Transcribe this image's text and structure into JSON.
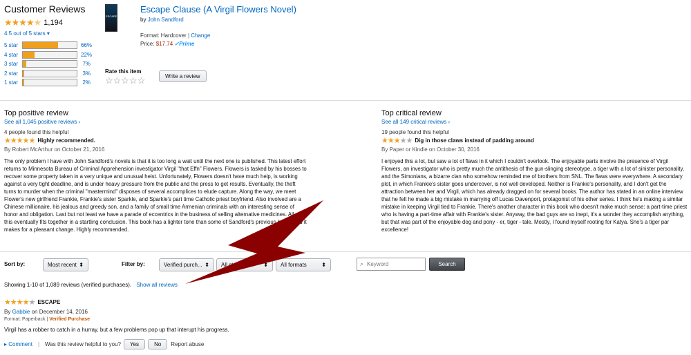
{
  "summary": {
    "title": "Customer Reviews",
    "count": "1,194",
    "rating_text": "4.5 out of 5 stars",
    "rating": 4.5,
    "histogram": [
      {
        "label": "5 star",
        "pct": "66%",
        "value": 66
      },
      {
        "label": "4 star",
        "pct": "22%",
        "value": 22
      },
      {
        "label": "3 star",
        "pct": "7%",
        "value": 7
      },
      {
        "label": "2 star",
        "pct": "3%",
        "value": 3
      },
      {
        "label": "1 star",
        "pct": "2%",
        "value": 2
      }
    ]
  },
  "product": {
    "title": "Escape Clause (A Virgil Flowers Novel)",
    "by": "by",
    "author": "John Sandford",
    "format_label": "Format:",
    "format": "Hardcover",
    "change": "Change",
    "price_label": "Price:",
    "price": "$17.74",
    "prime": "✓Prime",
    "rate_label": "Rate this item",
    "write_review": "Write a review"
  },
  "positive": {
    "heading": "Top positive review",
    "see_all": "See all 1,045 positive reviews ›",
    "helpful": "4 people found this helpful",
    "title": "Highly recommended.",
    "rating": 5,
    "byline": "By Robert McArthur on October 21, 2016",
    "body": "The only problem I have with John Sandford's novels is that it is too long a wait until the next one is published. This latest effort returns to Minnesota Bureau of Criminal Apprehension investigator Virgil \"that Effn\" Flowers. Flowers is tasked by his bosses to recover some property taken in a very unique and unusual heist. Unfortunately, Flowers doesn't have much help, is working against a very tight deadline, and is under heavy pressure from the public and the press to get results. Eventually, the theft turns to murder when the criminal \"mastermind\" disposes of several accomplices to elude capture. Along the way, we meet Flower's new girlfriend Frankie, Frankie's sister Sparkle, and Sparkle's part time Catholic priest boyfriend. Also involved are a Chinese millionaire, his jealous and greedy son, and a family of small time Armenian criminals with an interesting sense of honor and obligation. Last but not least we have a parade of eccentrics in the business of selling alternative medicines. All of this eventually fits together in a startling conclusion. This book has a lighter tone than some of Sandford's previous books and it makes for a pleasant change. Highly recommended."
  },
  "critical": {
    "heading": "Top critical review",
    "see_all": "See all 149 critical reviews ›",
    "helpful": "19 people found this helpful",
    "title": "Dig in those claws instead of padding around",
    "rating": 3,
    "byline": "By Paper or Kindle on October 30, 2016",
    "body": "I enjoyed this a lot, but saw a lot of flaws in it which I couldn't overlook. The enjoyable parts involve the presence of Virgil Flowers, an investigator who is pretty much the antithesis of the gun-slinging stereotype, a tiger with a lot of sinister personality, and the Simonians, a bizarre clan who somehow reminded me of brothers from SNL. The flaws were everywhere. A secondary plot, in which Frankie's sister goes undercover, is not well developed. Neither is Frankie's personality, and I don't get the attraction between her and Virgil, which has already dragged on for several books. The author has stated in an online interview that he felt he made a big mistake in marrying off Lucas Davenport, protagonist of his other series. I think he's making a similar mistake in keeping Virgil tied to Frankie. There's another character in this book who doesn't make much sense: a part-time priest who is having a part-time affair with Frankie's sister. Anyway, the bad guys are so inept, it's a wonder they accomplish anything, but that was part of the enjoyable dog and pony - er, tiger - tale. Mostly, I found myself rooting for Katya. She's a tiger par excellence!"
  },
  "filters": {
    "sort_label": "Sort by:",
    "sort_value": "Most recent",
    "filter_label": "Filter by:",
    "filter_value": "Verified purch...",
    "stars_value": "All stars",
    "formats_value": "All formats",
    "keyword_placeholder": "Keyword",
    "search": "Search",
    "showing": "Showing 1-10 of 1,089 reviews (verified purchases).",
    "show_all": "Show all reviews"
  },
  "first_review": {
    "rating": 4,
    "title": "ESCAPE",
    "by": "By",
    "author": "Gabbie",
    "date": "on December 14, 2016",
    "format": "Format: Paperback",
    "verified": "Verified Purchase",
    "body": "Virgil has a robber to catch in a hurray, but a few problems pop up that interupt his progress.",
    "comment": "Comment",
    "helpful_q": "Was this review helpful to you?",
    "yes": "Yes",
    "no": "No",
    "report": "Report abuse"
  },
  "colors": {
    "star": "#f0a01e",
    "link": "#0066c0",
    "price": "#b12704",
    "arrow": "#8b0000"
  }
}
